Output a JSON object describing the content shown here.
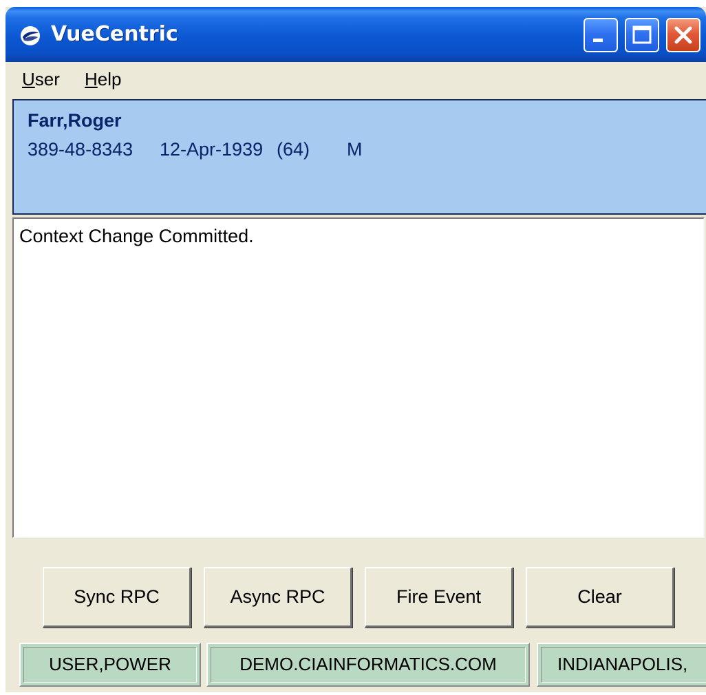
{
  "window": {
    "title": "VueCentric",
    "icon": "vuecentric-logo-icon",
    "controls": {
      "minimize": "minimize-icon",
      "maximize": "maximize-icon",
      "close": "close-icon"
    }
  },
  "menu": {
    "items": [
      {
        "label_u": "U",
        "label_rest": "ser"
      },
      {
        "label_u": "H",
        "label_rest": "elp"
      }
    ]
  },
  "patient": {
    "name": "Farr,Roger",
    "ssn": "389-48-8343",
    "dob": "12-Apr-1939",
    "age": "(64)",
    "sex": "M"
  },
  "log": {
    "lines": [
      "Context Change Committed."
    ]
  },
  "buttons": {
    "sync_rpc": "Sync RPC",
    "async_rpc": "Async RPC",
    "fire_event": "Fire Event",
    "clear": "Clear"
  },
  "status": {
    "user": "USER,POWER",
    "server": "DEMO.CIAINFORMATICS.COM",
    "location": "INDIANAPOLIS,"
  },
  "colors": {
    "titlebar": "#0b58d2",
    "banner": "#a6caf0",
    "banner_text": "#0a246a",
    "status_panel": "#b9d9c2",
    "window_bg": "#ece9d8"
  }
}
